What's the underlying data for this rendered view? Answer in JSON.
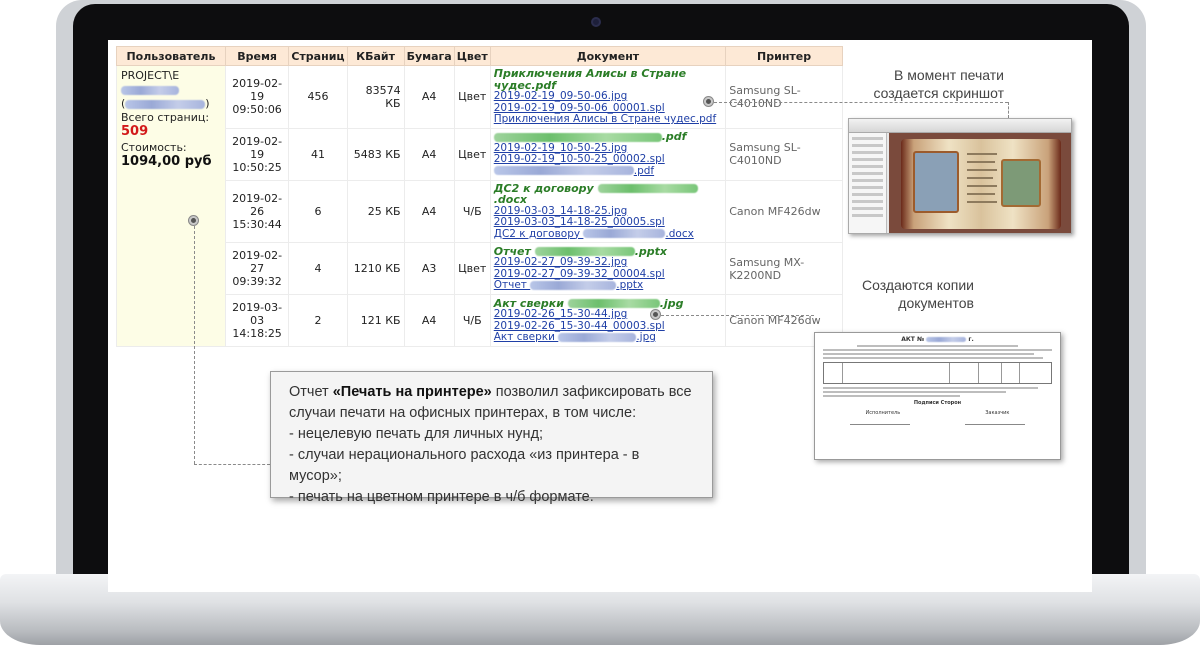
{
  "report": {
    "headers": [
      "Пользователь",
      "Время",
      "Страниц",
      "КБайт",
      "Бумага",
      "Цвет",
      "Документ",
      "Принтер"
    ],
    "user": {
      "account_prefix": "PROJECT\\Е",
      "paren_open": "(",
      "paren_close": ")",
      "total_pages_label": "Всего страниц:",
      "total_pages_value": "509",
      "cost_label": "Стоимость:",
      "cost_value": "1094,00 руб"
    },
    "rows": [
      {
        "date": "2019-02-19",
        "time": "09:50:06",
        "pages": "456",
        "kb": "83574 КБ",
        "paper": "A4",
        "color": "Цвет",
        "doc_title": "Приключения Алисы в Стране чудес.pdf",
        "doc_title_prefix": "",
        "doc_title_suffix": "",
        "link1": "2019-02-19_09-50-06.jpg",
        "link2": "2019-02-19_09-50-06_00001.spl",
        "link3": "Приключения Алисы в Стране чудес.pdf",
        "link3_prefix": "",
        "link3_suffix": "",
        "printer": "Samsung SL-C4010ND"
      },
      {
        "date": "2019-02-19",
        "time": "10:50:25",
        "pages": "41",
        "kb": "5483 КБ",
        "paper": "A4",
        "color": "Цвет",
        "doc_title": "",
        "doc_title_prefix": "",
        "doc_title_suffix": ".pdf",
        "link1": "2019-02-19_10-50-25.jpg",
        "link2": "2019-02-19_10-50-25_00002.spl",
        "link3": "",
        "link3_prefix": "",
        "link3_suffix": ".pdf",
        "printer": "Samsung SL-C4010ND"
      },
      {
        "date": "2019-02-26",
        "time": "15:30:44",
        "pages": "6",
        "kb": "25 КБ",
        "paper": "A4",
        "color": "Ч/Б",
        "doc_title": "",
        "doc_title_prefix": "ДС2 к договору ",
        "doc_title_suffix": ".docx",
        "link1": "2019-03-03_14-18-25.jpg",
        "link2": "2019-03-03_14-18-25_00005.spl",
        "link3": "",
        "link3_prefix": "ДС2 к договору ",
        "link3_suffix": ".docx",
        "printer": "Canon MF426dw"
      },
      {
        "date": "2019-02-27",
        "time": "09:39:32",
        "pages": "4",
        "kb": "1210 КБ",
        "paper": "A3",
        "color": "Цвет",
        "doc_title": "",
        "doc_title_prefix": "Отчет ",
        "doc_title_suffix": ".pptx",
        "link1": "2019-02-27_09-39-32.jpg",
        "link2": "2019-02-27_09-39-32_00004.spl",
        "link3": "",
        "link3_prefix": "Отчет ",
        "link3_suffix": ".pptx",
        "printer": "Samsung MX-K2200ND"
      },
      {
        "date": "2019-03-03",
        "time": "14:18:25",
        "pages": "2",
        "kb": "121 КБ",
        "paper": "A4",
        "color": "Ч/Б",
        "doc_title": "",
        "doc_title_prefix": "Акт сверки ",
        "doc_title_suffix": ".jpg",
        "link1": "2019-02-26_15-30-44.jpg",
        "link2": "2019-02-26_15-30-44_00003.spl",
        "link3": "",
        "link3_prefix": "Акт сверки ",
        "link3_suffix": ".jpg",
        "printer": "Canon MF426dw"
      }
    ]
  },
  "annotations": {
    "screenshot_label_line1": "В момент печати",
    "screenshot_label_line2": "создается скриншот",
    "copies_label_line1": "Создаются копии",
    "copies_label_line2": "документов",
    "copy_doc_title": "АКТ №",
    "copy_doc_title_suffix": "г.",
    "copy_doc_sign_left": "Исполнитель",
    "copy_doc_sign_right": "Заказчик",
    "copy_doc_signatures_title": "Подписи Сторон"
  },
  "callout": {
    "prefix": "Отчет ",
    "bold": "«Печать на принтере»",
    "line1_rest": " позволил зафиксировать все",
    "line2": "случаи печати на офисных принтерах, в том числе:",
    "line3": "- нецелевую печать для личных нунд;",
    "line4": "- случаи нерационального расхода «из принтера - в мусор»;",
    "line5": "- печать на цветном принтере в ч/б формате."
  },
  "colors": {
    "header_bg": "#fde9d6",
    "user_cell_bg": "#fdfde6",
    "total_pages": "#d21a1a",
    "doc_title": "#2b7d27",
    "doc_link": "#1f3fa6"
  }
}
